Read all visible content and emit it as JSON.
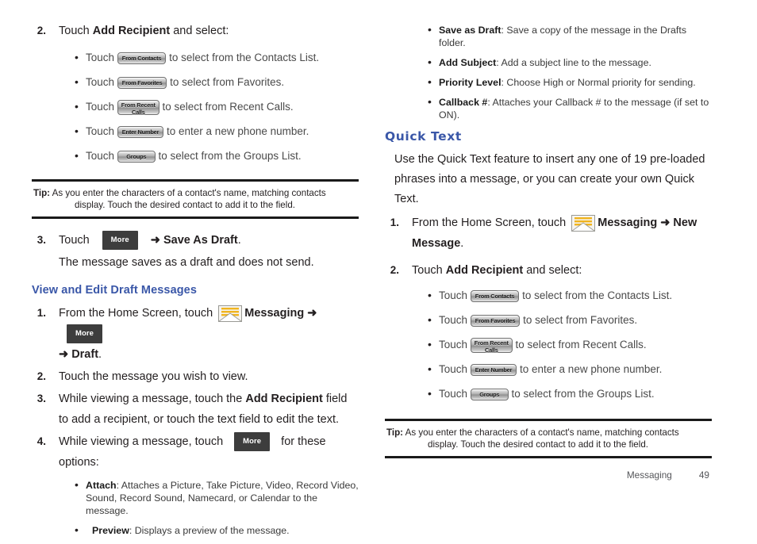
{
  "footer": {
    "section": "Messaging",
    "page": "49"
  },
  "colors": {
    "heading_blue": "#3a57a8",
    "chip_dark": "#3d3d3d",
    "text": "#231f20"
  },
  "icons": {
    "envelope": "messaging-envelope-icon"
  },
  "chips": {
    "from_contacts": "From Contacts",
    "from_favorites": "From Favorites",
    "from_recent_l1": "From Recent",
    "from_recent_l2": "Calls",
    "enter_number": "Enter Number",
    "groups": "Groups",
    "more": "More"
  },
  "left": {
    "step2": {
      "num": "2.",
      "lead_touch": "Touch ",
      "lead_bold": "Add Recipient",
      "lead_tail": " and select:",
      "bullets": [
        {
          "pre": "Touch ",
          "chip": "from_contacts",
          "post": " to select from the Contacts List."
        },
        {
          "pre": "Touch ",
          "chip": "from_favorites",
          "post": " to select from Favorites."
        },
        {
          "pre": "Touch ",
          "chip": "from_recent",
          "post": " to select from Recent Calls."
        },
        {
          "pre": "Touch ",
          "chip": "enter_number",
          "post": " to enter a new phone number."
        },
        {
          "pre": "Touch ",
          "chip": "groups",
          "post": " to select from the Groups List."
        }
      ]
    },
    "tip": {
      "label": "Tip:",
      "line1": " As you enter the characters of a contact's name, matching contacts",
      "line2": "display. Touch the desired contact to add it to the field."
    },
    "step3": {
      "num": "3.",
      "pre": "Touch ",
      "arrow": "➜",
      "bold": "Save As Draft",
      "tail": ".",
      "note": "The message saves as a draft and does not send."
    },
    "heading": "View and Edit Draft Messages",
    "step1": {
      "num": "1.",
      "pre": "From the Home Screen, touch ",
      "app": "Messaging",
      "arrow": "➜",
      "arrow2": "➜",
      "bold2": "Draft",
      "tail": "."
    },
    "step2b": {
      "num": "2.",
      "text": "Touch the message you wish to view."
    },
    "step3b": {
      "num": "3.",
      "pre": "While viewing a message, touch the ",
      "bold": "Add Recipient",
      "post": " field to add a recipient, or touch the text field to edit the text."
    },
    "step4": {
      "num": "4.",
      "pre": "While viewing a message, touch ",
      "post": " for these options:",
      "options": [
        {
          "term": "Attach",
          "desc": ": Attaches a Picture, Take Picture, Video, Record Video, Sound, Record Sound, Namecard, or Calendar to the message."
        },
        {
          "term": "Preview",
          "desc": ": Displays a preview of the message."
        }
      ]
    }
  },
  "right": {
    "options": [
      {
        "term": "Save as Draft",
        "desc": ": Save a copy of the message in the Drafts folder."
      },
      {
        "term": "Add Subject",
        "desc": ": Add a subject line to the message."
      },
      {
        "term": "Priority Level",
        "desc": ": Choose High or Normal priority for sending."
      },
      {
        "term": "Callback #",
        "desc": ": Attaches your Callback # to the message (if set to ON)."
      }
    ],
    "heading": "Quick Text",
    "intro_l1": "Use the Quick Text feature to insert any one of 19 pre-loaded",
    "intro_l2": "phrases into a message, or you can create your own Quick Text.",
    "step1": {
      "num": "1.",
      "pre": "From the Home Screen, touch ",
      "app": "Messaging",
      "arrow": "➜",
      "bold_new": "New Message",
      "tail": "."
    },
    "step2": {
      "num": "2.",
      "lead_touch": "Touch ",
      "lead_bold": "Add Recipient",
      "lead_tail": " and select:",
      "bullets": [
        {
          "pre": "Touch ",
          "chip": "from_contacts",
          "post": " to select from the Contacts List."
        },
        {
          "pre": "Touch ",
          "chip": "from_favorites",
          "post": " to select from Favorites."
        },
        {
          "pre": "Touch ",
          "chip": "from_recent",
          "post": " to select from Recent Calls."
        },
        {
          "pre": "Touch ",
          "chip": "enter_number",
          "post": " to enter a new phone number."
        },
        {
          "pre": "Touch ",
          "chip": "groups",
          "post": " to select from the Groups List."
        }
      ]
    },
    "tip": {
      "label": "Tip:",
      "line1": " As you enter the characters of a contact's name, matching contacts",
      "line2": "display. Touch the desired contact to add it to the field."
    }
  }
}
